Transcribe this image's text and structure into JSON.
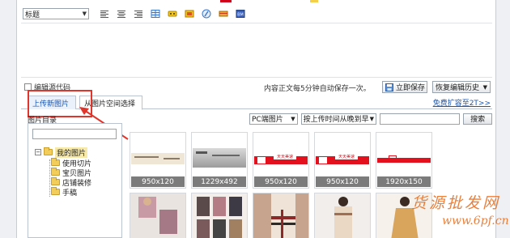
{
  "toolbar": {
    "format_select": "标题",
    "icons": [
      "align-left-icon",
      "align-center-icon",
      "align-right-icon",
      "table-icon",
      "emoticon-icon",
      "media-icon",
      "flash-icon",
      "special-icon",
      "html-icon"
    ]
  },
  "status": {
    "source_code_label": "编辑源代码",
    "autosave_text": "内容正文每5分钟自动保存一次。",
    "save_now_label": "立即保存",
    "restore_history_label": "恢复编辑历史"
  },
  "tabs": {
    "upload_label": "上传新图片",
    "space_label": "从图片空间选择",
    "expand_link": "免费扩容至2T>>"
  },
  "tree": {
    "title": "图片目录",
    "root": "我的图片",
    "children": [
      "使用切片",
      "宝贝图片",
      "店铺装修",
      "手稿"
    ]
  },
  "filters": {
    "device": "PC端图片",
    "sort": "按上传时间从晚到早",
    "search_label": "搜索"
  },
  "thumbnails": [
    {
      "size": "950x120"
    },
    {
      "size": "1229x492"
    },
    {
      "size": "950x120",
      "banner_text": "天天美速"
    },
    {
      "size": "950x120",
      "banner_text": "天天美速"
    },
    {
      "size": "1920x150"
    }
  ],
  "watermark": {
    "title": "货源批发网",
    "url": "www.6pf.cn"
  },
  "colors": {
    "tab_active": "#1b56b0",
    "callout_red": "#e0352b",
    "watermark": "#e86a1a"
  }
}
